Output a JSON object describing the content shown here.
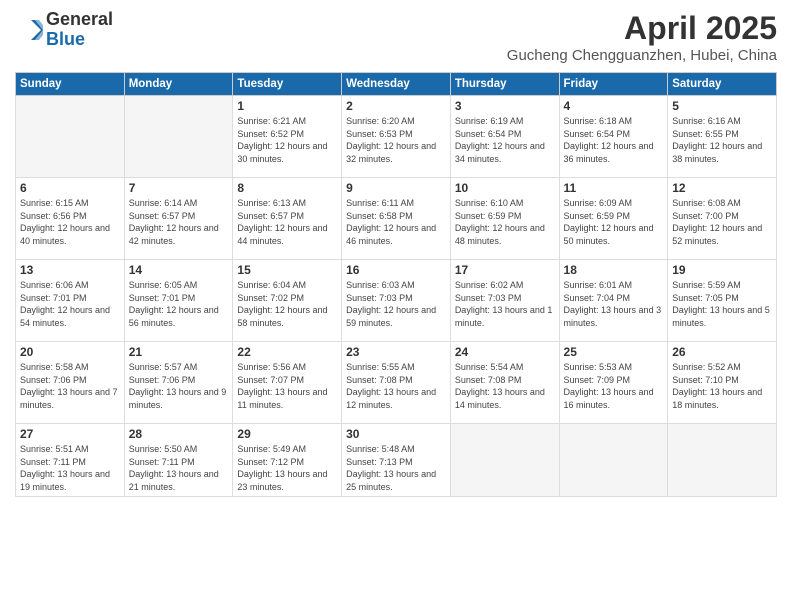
{
  "header": {
    "logo": {
      "general": "General",
      "blue": "Blue"
    },
    "month": "April 2025",
    "location": "Gucheng Chengguanzhen, Hubei, China"
  },
  "days_of_week": [
    "Sunday",
    "Monday",
    "Tuesday",
    "Wednesday",
    "Thursday",
    "Friday",
    "Saturday"
  ],
  "weeks": [
    [
      {
        "day": "",
        "empty": true
      },
      {
        "day": "",
        "empty": true
      },
      {
        "day": "1",
        "sunrise": "6:21 AM",
        "sunset": "6:52 PM",
        "daylight": "12 hours and 30 minutes."
      },
      {
        "day": "2",
        "sunrise": "6:20 AM",
        "sunset": "6:53 PM",
        "daylight": "12 hours and 32 minutes."
      },
      {
        "day": "3",
        "sunrise": "6:19 AM",
        "sunset": "6:54 PM",
        "daylight": "12 hours and 34 minutes."
      },
      {
        "day": "4",
        "sunrise": "6:18 AM",
        "sunset": "6:54 PM",
        "daylight": "12 hours and 36 minutes."
      },
      {
        "day": "5",
        "sunrise": "6:16 AM",
        "sunset": "6:55 PM",
        "daylight": "12 hours and 38 minutes."
      }
    ],
    [
      {
        "day": "6",
        "sunrise": "6:15 AM",
        "sunset": "6:56 PM",
        "daylight": "12 hours and 40 minutes."
      },
      {
        "day": "7",
        "sunrise": "6:14 AM",
        "sunset": "6:57 PM",
        "daylight": "12 hours and 42 minutes."
      },
      {
        "day": "8",
        "sunrise": "6:13 AM",
        "sunset": "6:57 PM",
        "daylight": "12 hours and 44 minutes."
      },
      {
        "day": "9",
        "sunrise": "6:11 AM",
        "sunset": "6:58 PM",
        "daylight": "12 hours and 46 minutes."
      },
      {
        "day": "10",
        "sunrise": "6:10 AM",
        "sunset": "6:59 PM",
        "daylight": "12 hours and 48 minutes."
      },
      {
        "day": "11",
        "sunrise": "6:09 AM",
        "sunset": "6:59 PM",
        "daylight": "12 hours and 50 minutes."
      },
      {
        "day": "12",
        "sunrise": "6:08 AM",
        "sunset": "7:00 PM",
        "daylight": "12 hours and 52 minutes."
      }
    ],
    [
      {
        "day": "13",
        "sunrise": "6:06 AM",
        "sunset": "7:01 PM",
        "daylight": "12 hours and 54 minutes."
      },
      {
        "day": "14",
        "sunrise": "6:05 AM",
        "sunset": "7:01 PM",
        "daylight": "12 hours and 56 minutes."
      },
      {
        "day": "15",
        "sunrise": "6:04 AM",
        "sunset": "7:02 PM",
        "daylight": "12 hours and 58 minutes."
      },
      {
        "day": "16",
        "sunrise": "6:03 AM",
        "sunset": "7:03 PM",
        "daylight": "12 hours and 59 minutes."
      },
      {
        "day": "17",
        "sunrise": "6:02 AM",
        "sunset": "7:03 PM",
        "daylight": "13 hours and 1 minute."
      },
      {
        "day": "18",
        "sunrise": "6:01 AM",
        "sunset": "7:04 PM",
        "daylight": "13 hours and 3 minutes."
      },
      {
        "day": "19",
        "sunrise": "5:59 AM",
        "sunset": "7:05 PM",
        "daylight": "13 hours and 5 minutes."
      }
    ],
    [
      {
        "day": "20",
        "sunrise": "5:58 AM",
        "sunset": "7:06 PM",
        "daylight": "13 hours and 7 minutes."
      },
      {
        "day": "21",
        "sunrise": "5:57 AM",
        "sunset": "7:06 PM",
        "daylight": "13 hours and 9 minutes."
      },
      {
        "day": "22",
        "sunrise": "5:56 AM",
        "sunset": "7:07 PM",
        "daylight": "13 hours and 11 minutes."
      },
      {
        "day": "23",
        "sunrise": "5:55 AM",
        "sunset": "7:08 PM",
        "daylight": "13 hours and 12 minutes."
      },
      {
        "day": "24",
        "sunrise": "5:54 AM",
        "sunset": "7:08 PM",
        "daylight": "13 hours and 14 minutes."
      },
      {
        "day": "25",
        "sunrise": "5:53 AM",
        "sunset": "7:09 PM",
        "daylight": "13 hours and 16 minutes."
      },
      {
        "day": "26",
        "sunrise": "5:52 AM",
        "sunset": "7:10 PM",
        "daylight": "13 hours and 18 minutes."
      }
    ],
    [
      {
        "day": "27",
        "sunrise": "5:51 AM",
        "sunset": "7:11 PM",
        "daylight": "13 hours and 19 minutes."
      },
      {
        "day": "28",
        "sunrise": "5:50 AM",
        "sunset": "7:11 PM",
        "daylight": "13 hours and 21 minutes."
      },
      {
        "day": "29",
        "sunrise": "5:49 AM",
        "sunset": "7:12 PM",
        "daylight": "13 hours and 23 minutes."
      },
      {
        "day": "30",
        "sunrise": "5:48 AM",
        "sunset": "7:13 PM",
        "daylight": "13 hours and 25 minutes."
      },
      {
        "day": "",
        "empty": true
      },
      {
        "day": "",
        "empty": true
      },
      {
        "day": "",
        "empty": true
      }
    ]
  ],
  "labels": {
    "sunrise": "Sunrise:",
    "sunset": "Sunset:",
    "daylight": "Daylight:"
  }
}
